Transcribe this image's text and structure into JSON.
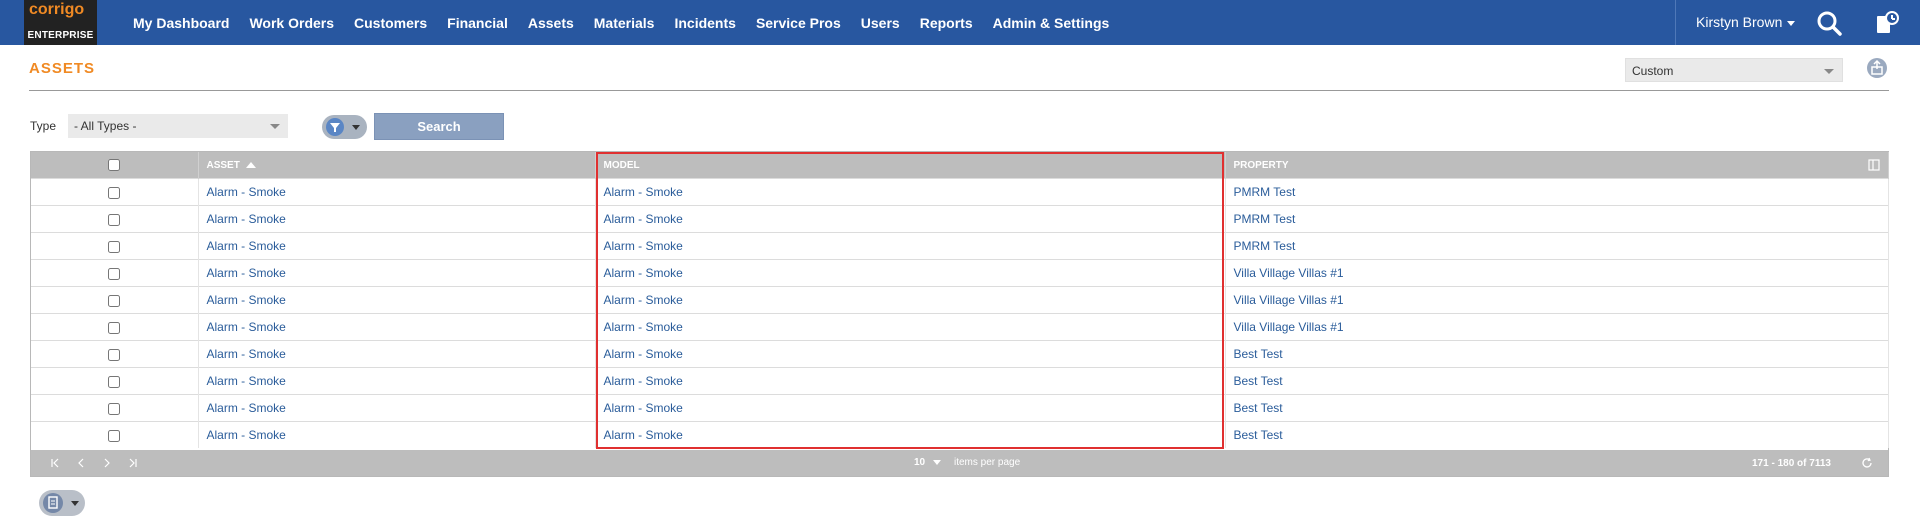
{
  "logo": {
    "top": "corrigo",
    "bottom": "ENTERPRISE"
  },
  "nav": [
    "My Dashboard",
    "Work Orders",
    "Customers",
    "Financial",
    "Assets",
    "Materials",
    "Incidents",
    "Service Pros",
    "Users",
    "Reports",
    "Admin & Settings"
  ],
  "user": {
    "name": "Kirstyn Brown"
  },
  "page": {
    "title": "ASSETS",
    "view_select": "Custom"
  },
  "filters": {
    "type_label": "Type",
    "type_value": "- All Types -",
    "search_label": "Search"
  },
  "table": {
    "columns": [
      "ASSET",
      "MODEL",
      "PROPERTY"
    ],
    "rows": [
      [
        "Alarm - Smoke",
        "Alarm - Smoke",
        "PMRM Test"
      ],
      [
        "Alarm - Smoke",
        "Alarm - Smoke",
        "PMRM Test"
      ],
      [
        "Alarm - Smoke",
        "Alarm - Smoke",
        "PMRM Test"
      ],
      [
        "Alarm - Smoke",
        "Alarm - Smoke",
        "Villa Village Villas #1"
      ],
      [
        "Alarm - Smoke",
        "Alarm - Smoke",
        "Villa Village Villas #1"
      ],
      [
        "Alarm - Smoke",
        "Alarm - Smoke",
        "Villa Village Villas #1"
      ],
      [
        "Alarm - Smoke",
        "Alarm - Smoke",
        "Best Test"
      ],
      [
        "Alarm - Smoke",
        "Alarm - Smoke",
        "Best Test"
      ],
      [
        "Alarm - Smoke",
        "Alarm - Smoke",
        "Best Test"
      ],
      [
        "Alarm - Smoke",
        "Alarm - Smoke",
        "Best Test"
      ]
    ]
  },
  "pager": {
    "per_page": "10",
    "per_page_label": "items per page",
    "range": "171 - 180 of 7113"
  },
  "colors": {
    "topbar": "#2857a0",
    "accent": "#f08a24",
    "link": "#2a5c9a",
    "highlight": "#e03030"
  }
}
